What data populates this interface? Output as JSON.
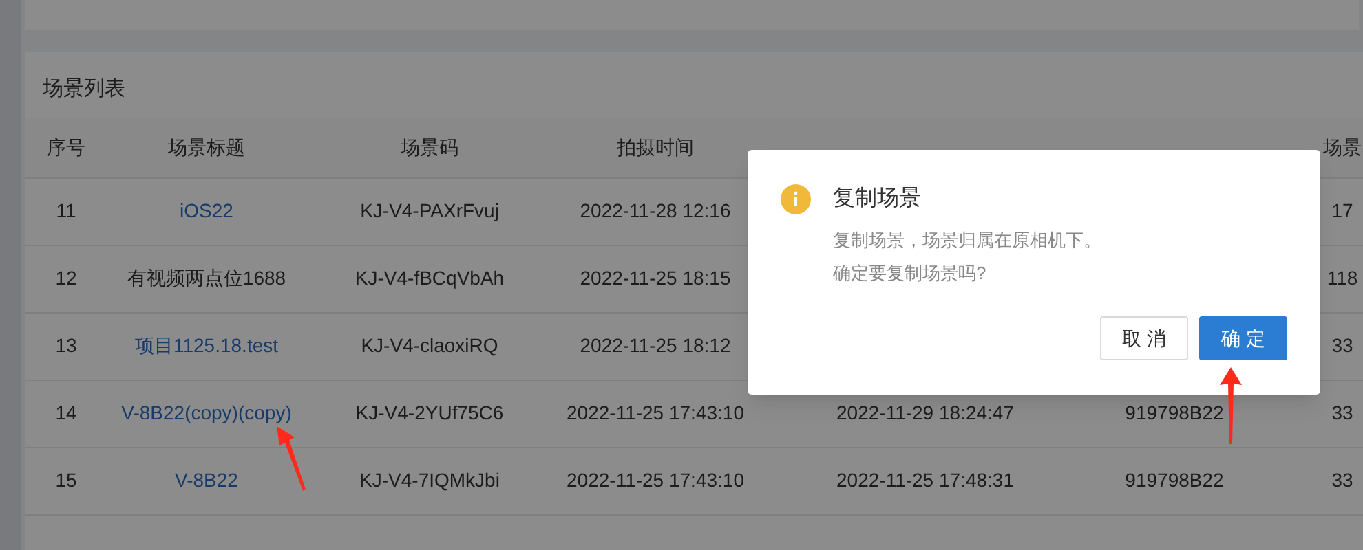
{
  "panel": {
    "title": "场景列表"
  },
  "table": {
    "columns": [
      "序号",
      "场景标题",
      "场景码",
      "拍摄时间",
      "",
      "",
      "场景"
    ],
    "rows": [
      {
        "cells": [
          "11",
          "iOS22",
          "KJ-V4-PAXrFvuj",
          "2022-11-28 12:16",
          "",
          "",
          "17"
        ],
        "link": true
      },
      {
        "cells": [
          "12",
          "有视频两点位1688",
          "KJ-V4-fBCqVbAh",
          "2022-11-25 18:15",
          "",
          "",
          "118"
        ],
        "link": false
      },
      {
        "cells": [
          "13",
          "项目1125.18.test",
          "KJ-V4-claoxiRQ",
          "2022-11-25 18:12",
          "",
          "",
          "33"
        ],
        "link": true
      },
      {
        "cells": [
          "14",
          "V-8B22(copy)(copy)",
          "KJ-V4-2YUf75C6",
          "2022-11-25 17:43:10",
          "2022-11-29 18:24:47",
          "919798B22",
          "33"
        ],
        "link": true
      },
      {
        "cells": [
          "15",
          "V-8B22",
          "KJ-V4-7IQMkJbi",
          "2022-11-25 17:43:10",
          "2022-11-25 17:48:31",
          "919798B22",
          "33"
        ],
        "link": true
      }
    ]
  },
  "dialog": {
    "title": "复制场景",
    "lines": [
      "复制场景，场景归属在原相机下。",
      "确定要复制场景吗?"
    ],
    "buttons": [
      {
        "label": "取 消",
        "primary": false
      },
      {
        "label": "确 定",
        "primary": true
      }
    ]
  }
}
